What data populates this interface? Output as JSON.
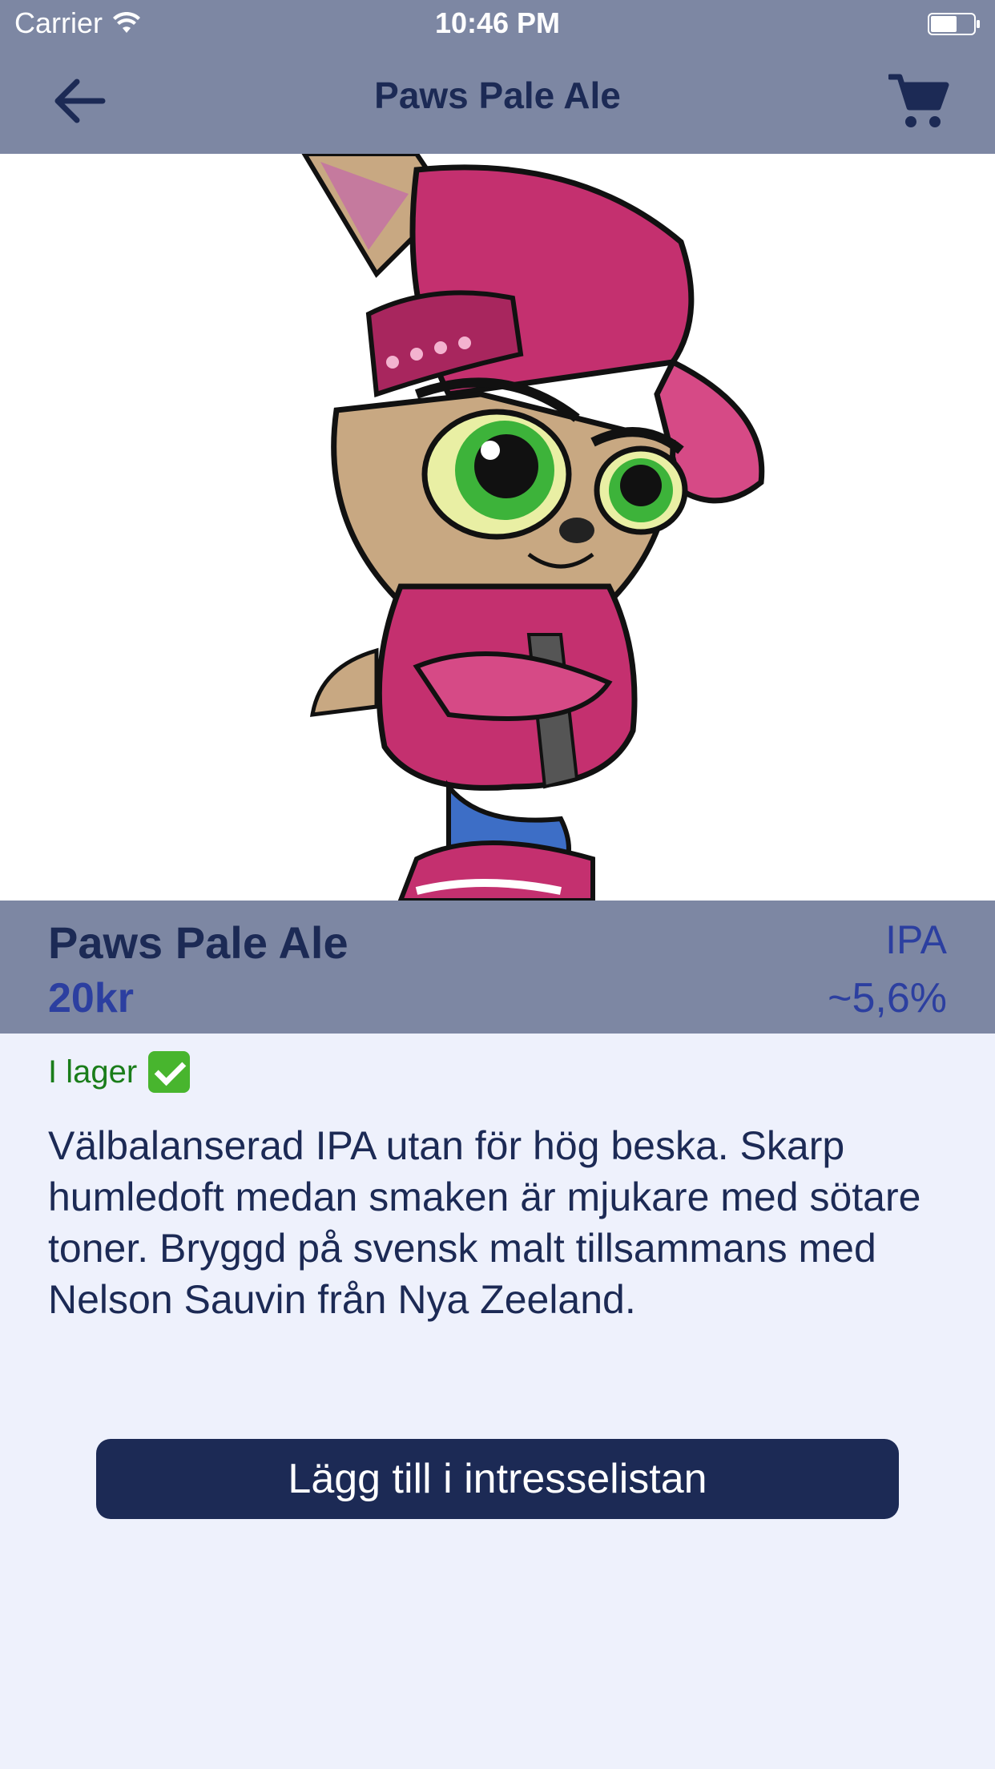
{
  "status_bar": {
    "carrier": "Carrier",
    "time": "10:46 PM"
  },
  "nav": {
    "title": "Paws Pale Ale",
    "back_icon": "arrow-left-icon",
    "cart_icon": "cart-icon"
  },
  "product": {
    "image": "cartoon-cat-illustration",
    "name": "Paws Pale Ale",
    "price": "20kr",
    "type": "IPA",
    "abv": "~5,6%",
    "stock_label": "I lager",
    "stock_icon": "check-mark-icon",
    "description": "Välbalanserad IPA utan för hög beska. Skarp humledoft medan smaken är mjukare med sötare toner. Bryggd på svensk malt tillsammans med Nelson Sauvin från Nya Zeeland."
  },
  "actions": {
    "add_to_interest_label": "Lägg till i intresselistan"
  },
  "colors": {
    "header_bg": "#7d87a3",
    "page_bg": "#eef1fc",
    "primary_dark": "#1c2a55",
    "accent_blue": "#2c3fa0",
    "in_stock_green": "#1a7d1a"
  }
}
